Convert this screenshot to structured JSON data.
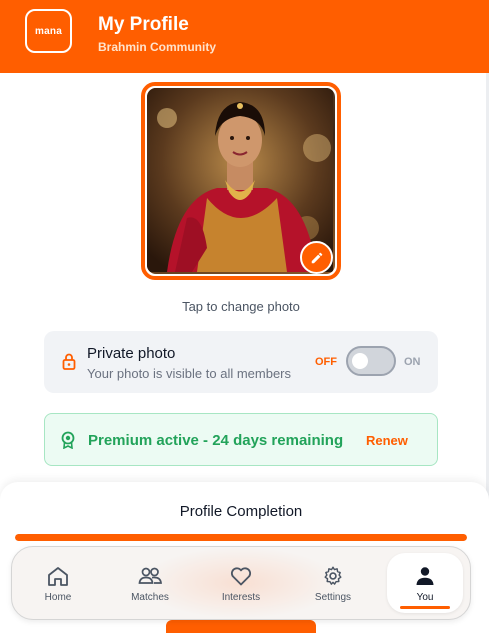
{
  "header": {
    "logo_text": "mana",
    "title": "My Profile",
    "subtitle": "Brahmin Community"
  },
  "photo": {
    "tap_hint": "Tap to change photo"
  },
  "private_photo": {
    "title": "Private photo",
    "description": "Your photo is visible to all members",
    "off_label": "OFF",
    "on_label": "ON",
    "enabled": false
  },
  "premium": {
    "status_text": "Premium active - 24 days remaining",
    "renew_label": "Renew"
  },
  "completion": {
    "title": "Profile Completion",
    "progress_percent": 100
  },
  "nav": {
    "items": [
      {
        "label": "Home",
        "icon": "home-icon"
      },
      {
        "label": "Matches",
        "icon": "people-icon"
      },
      {
        "label": "Interests",
        "icon": "heart-icon"
      },
      {
        "label": "Settings",
        "icon": "gear-icon"
      },
      {
        "label": "You",
        "icon": "person-icon",
        "active": true
      }
    ]
  },
  "colors": {
    "brand": "#ff5e00",
    "success": "#22a35a"
  }
}
